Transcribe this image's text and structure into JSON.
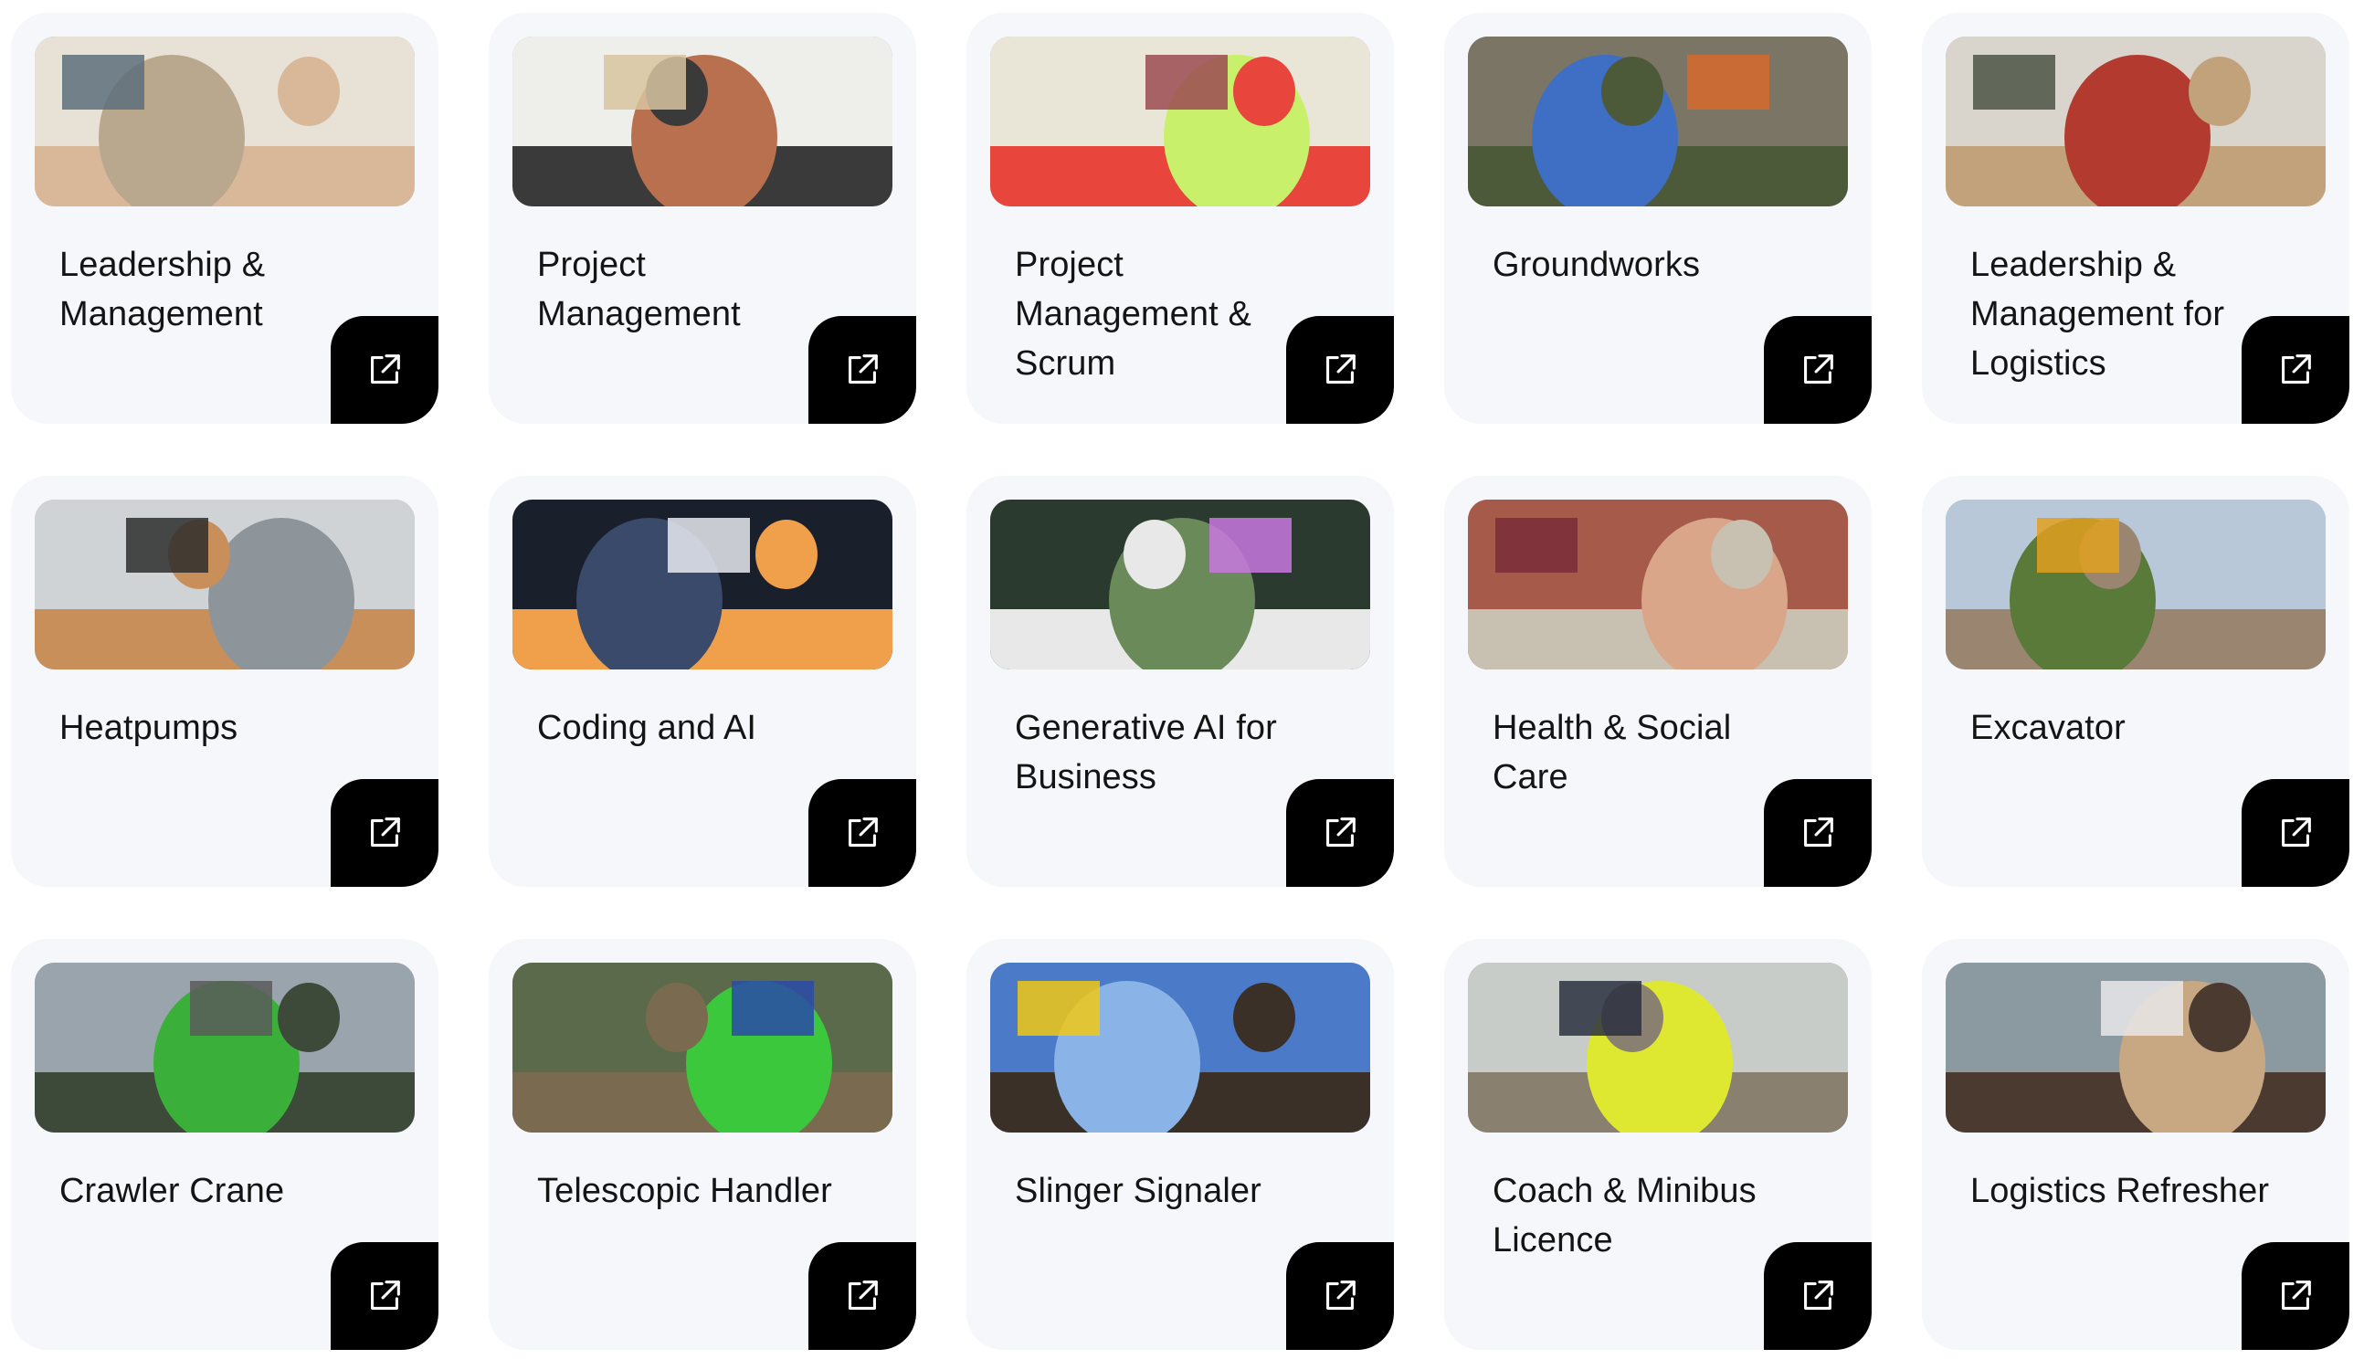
{
  "courses": [
    {
      "title": "Leadership & Management",
      "thumbnail": "team-meeting-whiteboard-photo",
      "icon": "external-link-icon",
      "palette": [
        "#e8e2d6",
        "#b9a78e",
        "#5d6f7c",
        "#d9b89a"
      ]
    },
    {
      "title": "Project Management",
      "thumbnail": "woman-writing-on-whiteboard-photo",
      "icon": "external-link-icon",
      "palette": [
        "#eeeeea",
        "#b8704f",
        "#d8c4a0",
        "#3a3a3a"
      ]
    },
    {
      "title": "Project Management & Scrum",
      "thumbnail": "sticky-notes-wall-photo",
      "icon": "external-link-icon",
      "palette": [
        "#e9e6d8",
        "#c9f06a",
        "#9b4a52",
        "#e8453c"
      ]
    },
    {
      "title": "Groundworks",
      "thumbnail": "construction-worker-photo",
      "icon": "external-link-icon",
      "palette": [
        "#7a7565",
        "#3f6fc4",
        "#d66a2c",
        "#4d5a3a"
      ]
    },
    {
      "title": "Leadership & Management for Logistics",
      "thumbnail": "warehouse-worker-photo",
      "icon": "external-link-icon",
      "palette": [
        "#d9d4cc",
        "#b33a2f",
        "#4b5545",
        "#c2a27a"
      ]
    },
    {
      "title": "Heatpumps",
      "thumbnail": "engineer-at-electrical-panel-photo",
      "icon": "external-link-icon",
      "palette": [
        "#cfd3d6",
        "#8d949a",
        "#2d2d2d",
        "#c98f5a"
      ]
    },
    {
      "title": "Coding and AI",
      "thumbnail": "developer-screens-photo",
      "icon": "external-link-icon",
      "palette": [
        "#1a1f2c",
        "#3a4a6a",
        "#e8eaf0",
        "#f0a04a"
      ]
    },
    {
      "title": "Generative AI for Business",
      "thumbnail": "laptop-chatgpt-photo",
      "icon": "external-link-icon",
      "palette": [
        "#2a3a2e",
        "#6a8a5a",
        "#c878e0",
        "#e8e8e8"
      ]
    },
    {
      "title": "Health & Social Care",
      "thumbnail": "carer-and-man-laughing-photo",
      "icon": "external-link-icon",
      "palette": [
        "#a65a4a",
        "#d9a68a",
        "#7a2d3a",
        "#c8c0b0"
      ]
    },
    {
      "title": "Excavator",
      "thumbnail": "excavator-on-site-photo",
      "icon": "external-link-icon",
      "palette": [
        "#b8c8d8",
        "#5a7a3a",
        "#e0a020",
        "#9a8670"
      ]
    },
    {
      "title": "Crawler Crane",
      "thumbnail": "green-crawler-crane-photo",
      "icon": "external-link-icon",
      "palette": [
        "#9aa4ac",
        "#3ab03a",
        "#5a5a5a",
        "#3d4a3a"
      ]
    },
    {
      "title": "Telescopic Handler",
      "thumbnail": "telehandler-on-site-photo",
      "icon": "external-link-icon",
      "palette": [
        "#5a6a4a",
        "#3cc83c",
        "#2a4aa8",
        "#7a6a50"
      ]
    },
    {
      "title": "Slinger Signaler",
      "thumbnail": "slinger-hard-hat-photo",
      "icon": "external-link-icon",
      "palette": [
        "#4a7ac8",
        "#8ab4e8",
        "#f0c814",
        "#3a3028"
      ]
    },
    {
      "title": "Coach & Minibus Licence",
      "thumbnail": "bus-drivers-photo",
      "icon": "external-link-icon",
      "palette": [
        "#c8ccc8",
        "#dfe830",
        "#2a3040",
        "#8a8070"
      ]
    },
    {
      "title": "Logistics Refresher",
      "thumbnail": "warehouse-workers-boxes-photo",
      "icon": "external-link-icon",
      "palette": [
        "#8a9aa0",
        "#c8a882",
        "#e8e8ea",
        "#4a3a30"
      ]
    }
  ]
}
